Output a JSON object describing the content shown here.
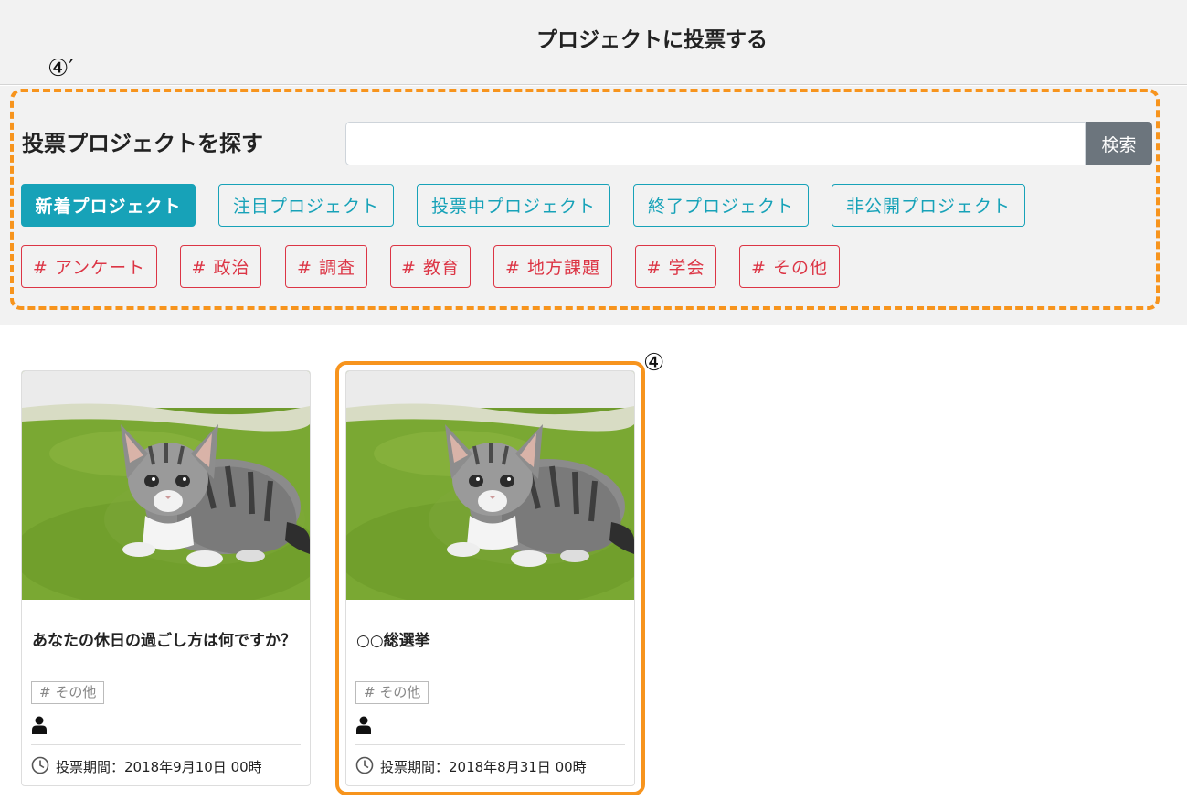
{
  "header": {
    "title": "プロジェクトに投票する"
  },
  "annotations": {
    "filter_marker": "④′",
    "card_marker": "④"
  },
  "search": {
    "label": "投票プロジェクトを探す",
    "input_value": "",
    "placeholder": "",
    "button_label": "検索"
  },
  "filters": {
    "status_buttons": [
      {
        "label": "新着プロジェクト",
        "active": true
      },
      {
        "label": "注目プロジェクト",
        "active": false
      },
      {
        "label": "投票中プロジェクト",
        "active": false
      },
      {
        "label": "終了プロジェクト",
        "active": false
      },
      {
        "label": "非公開プロジェクト",
        "active": false
      }
    ],
    "tags": [
      "# アンケート",
      "# 政治",
      "# 調査",
      "# 教育",
      "# 地方課題",
      "# 学会",
      "# その他"
    ]
  },
  "cards": [
    {
      "title": "あなたの休日の過ごし方は何ですか？",
      "tag": "# その他",
      "period": "投票期間：2018年9月10日 00時",
      "image": "kitten-photo"
    },
    {
      "title": "○○総選挙",
      "tag": "# その他",
      "period": "投票期間：2018年8月31日 00時",
      "image": "kitten-photo"
    }
  ],
  "colors": {
    "accent_teal": "#17a2b8",
    "tag_red": "#dc3545",
    "annotation_orange": "#f7941d",
    "search_button": "#6c757d"
  },
  "icons": {
    "user": "user-icon",
    "clock": "clock-icon"
  }
}
